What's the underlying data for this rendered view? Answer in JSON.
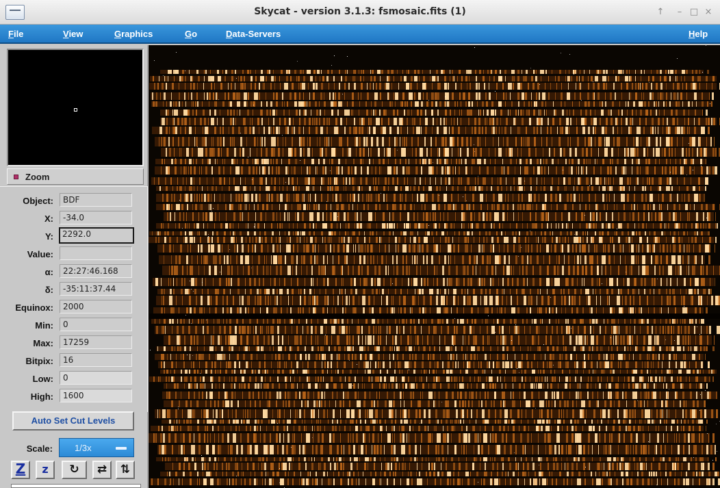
{
  "window": {
    "title": "Skycat - version 3.1.3: fsmosaic.fits (1)",
    "controls": [
      "↑",
      "–",
      "□",
      "×"
    ]
  },
  "menubar": {
    "file": {
      "mnemonic": "F",
      "rest": "ile"
    },
    "view": {
      "mnemonic": "V",
      "rest": "iew"
    },
    "graphics": {
      "mnemonic": "G",
      "rest": "raphics"
    },
    "go": {
      "mnemonic": "G",
      "rest": "o"
    },
    "data_servers": {
      "mnemonic": "D",
      "rest": "ata-Servers"
    },
    "help": {
      "mnemonic": "H",
      "rest": "elp"
    }
  },
  "zoom": {
    "label": "Zoom"
  },
  "info": {
    "object": {
      "label": "Object:",
      "value": "BDF"
    },
    "x": {
      "label": "X:",
      "value": "-34.0"
    },
    "y": {
      "label": "Y:",
      "value": "2292.0"
    },
    "value": {
      "label": "Value:",
      "value": ""
    },
    "alpha": {
      "label": "α:",
      "value": "22:27:46.168"
    },
    "delta": {
      "label": "δ:",
      "value": "-35:11:37.44"
    },
    "equinox": {
      "label": "Equinox:",
      "value": "2000"
    },
    "min": {
      "label": "Min:",
      "value": "0"
    },
    "max": {
      "label": "Max:",
      "value": "17259"
    },
    "bitpix": {
      "label": "Bitpix:",
      "value": "16"
    },
    "low": {
      "label": "Low:",
      "value": "0"
    },
    "high": {
      "label": "High:",
      "value": "1600"
    }
  },
  "auto_cut": {
    "label": "Auto Set Cut Levels"
  },
  "scale": {
    "label": "Scale:",
    "value": "1/3x"
  },
  "tools": {
    "zoom_in": "Z",
    "zoom_out": "z",
    "rotate": "↻",
    "flip_x": "⇄",
    "flip_y": "⇅"
  },
  "colors": {
    "menubar": "#2a88d2",
    "menu_text": "#ffffff",
    "panel": "#c8c8c8",
    "auto_cut_text": "#1f4fa3",
    "scale_select": "#3a9ae2",
    "spectrum_bright": "#ffd9a0",
    "spectrum_mid": "#c96e1c",
    "spectrum_dim": "#5a2a08",
    "background": "#0a0602"
  },
  "icons": {
    "window_menu": "window-menu-icon",
    "zoom_toggle": "zoom-toggle-icon",
    "scale_dropdown": "dropdown-bar-icon"
  }
}
